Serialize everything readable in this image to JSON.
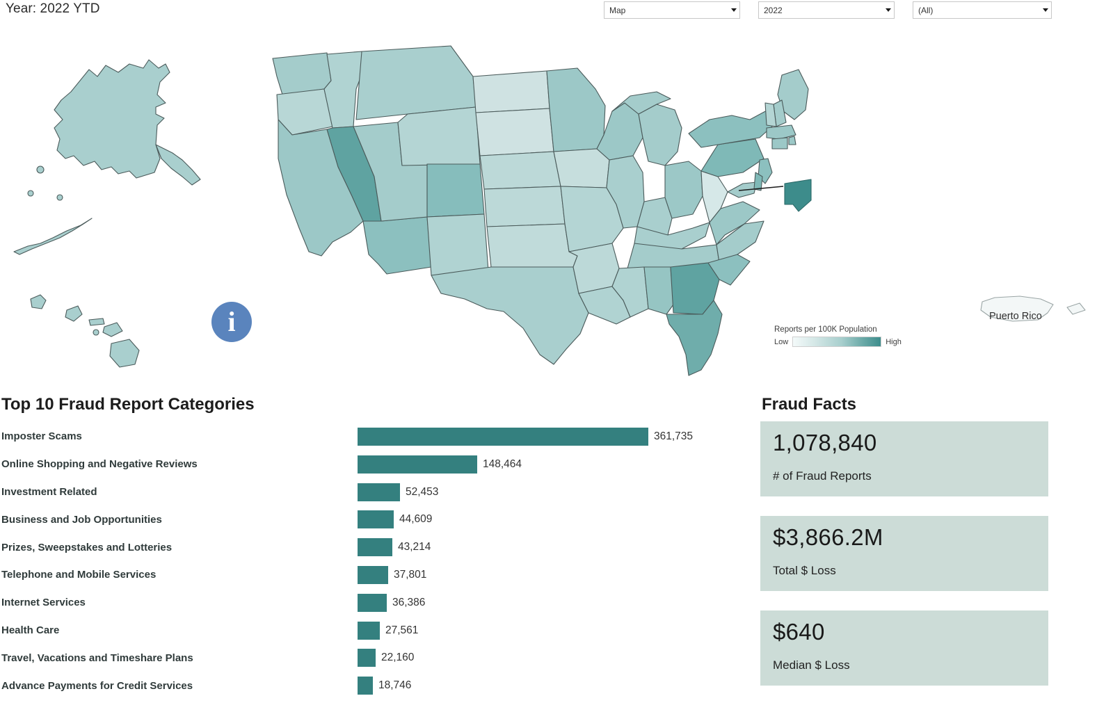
{
  "header": {
    "year_label": "Year: 2022 YTD",
    "filters": [
      {
        "name": "view",
        "value": "Map"
      },
      {
        "name": "year",
        "value": "2022"
      },
      {
        "name": "state",
        "value": "(All)"
      }
    ]
  },
  "map": {
    "legend_title": "Reports per 100K Population",
    "legend_low": "Low",
    "legend_high": "High",
    "puerto_rico_label": "Puerto Rico",
    "info_glyph": "i",
    "colors": {
      "lightest": "#cfe2e2",
      "light": "#bcd9d8",
      "mid": "#a4cccb",
      "dark": "#7fb9b7",
      "darkest": "#5fa3a1",
      "border": "#4a5a5a",
      "callout_fill": "#3d8c8b",
      "accent_info": "#5a84bd",
      "bar_teal": "#34807f",
      "card_bg": "#ccdcd7"
    }
  },
  "chart_data": {
    "type": "bar",
    "title": "Top 10 Fraud Report Categories",
    "xlabel": "",
    "ylabel": "",
    "orientation": "horizontal",
    "grid": false,
    "legend": "none",
    "xlim": [
      0,
      361735
    ],
    "categories": [
      "Imposter Scams",
      "Online Shopping and Negative Reviews",
      "Investment Related",
      "Business and Job Opportunities",
      "Prizes, Sweepstakes and Lotteries",
      "Telephone and Mobile Services",
      "Internet Services",
      "Health Care",
      "Travel, Vacations and Timeshare Plans",
      "Advance Payments for Credit Services"
    ],
    "values": [
      361735,
      148464,
      52453,
      44609,
      43214,
      37801,
      36386,
      27561,
      22160,
      18746
    ],
    "value_labels": [
      "361,735",
      "148,464",
      "52,453",
      "44,609",
      "43,214",
      "37,801",
      "36,386",
      "27,561",
      "22,160",
      "18,746"
    ]
  },
  "facts": {
    "title": "Fraud Facts",
    "cards": [
      {
        "value": "1,078,840",
        "label": "# of Fraud Reports"
      },
      {
        "value": "$3,866.2M",
        "label": "Total $ Loss"
      },
      {
        "value": "$640",
        "label": "Median $ Loss"
      }
    ]
  }
}
